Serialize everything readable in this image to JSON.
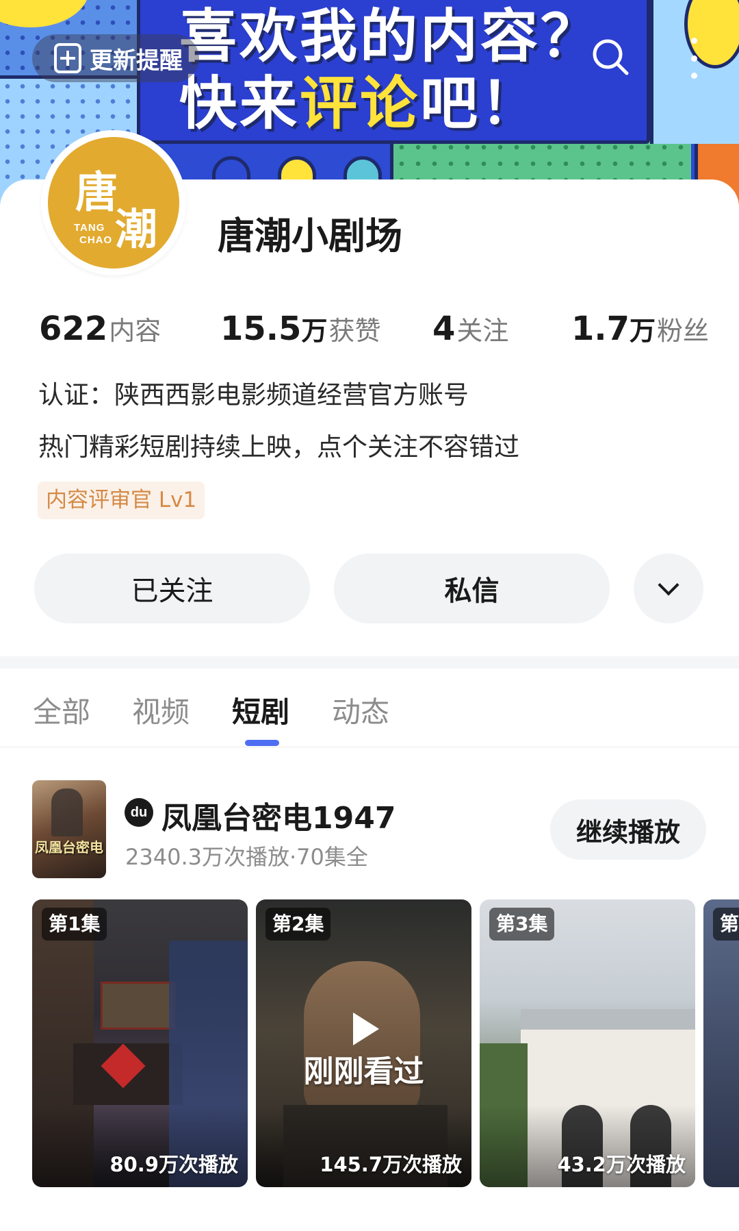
{
  "banner": {
    "line1": "喜欢我的内容？",
    "line2_a": "快来",
    "line2_b": "评论",
    "line2_c": "吧！",
    "remind_label": "更新提醒"
  },
  "profile": {
    "avatar_chars": [
      "唐",
      "潮"
    ],
    "avatar_en": [
      "TANG",
      "CHAO"
    ],
    "name": "唐潮小剧场",
    "stats": [
      {
        "num": "622",
        "unit": "",
        "label": "内容"
      },
      {
        "num": "15.5",
        "unit": "万",
        "label": "获赞"
      },
      {
        "num": "4",
        "unit": "",
        "label": "关注"
      },
      {
        "num": "1.7",
        "unit": "万",
        "label": "粉丝"
      }
    ],
    "certification": "认证：陕西西影电影频道经营官方账号",
    "bio": "热门精彩短剧持续上映，点个关注不容错过",
    "badge": "内容评审官 Lv1",
    "follow_label": "已关注",
    "message_label": "私信"
  },
  "tabs": [
    {
      "label": "全部",
      "active": false
    },
    {
      "label": "视频",
      "active": false
    },
    {
      "label": "短剧",
      "active": true
    },
    {
      "label": "动态",
      "active": false
    }
  ],
  "drama": {
    "logo": "du",
    "poster_text": "凤凰台密电",
    "title": "凤凰台密电1947",
    "meta": "2340.3万次播放·70集全",
    "continue_label": "继续播放",
    "episodes": [
      {
        "label": "第1集",
        "plays": "80.9万次播放"
      },
      {
        "label": "第2集",
        "plays": "145.7万次播放",
        "overlay": "刚刚看过"
      },
      {
        "label": "第3集",
        "plays": "43.2万次播放"
      },
      {
        "label": "第"
      }
    ]
  },
  "colors": {
    "accent": "#4e6ef2",
    "badge_text": "#d48a47",
    "badge_bg": "#fbf1e8",
    "avatar_bg": "#e2aa2f"
  }
}
